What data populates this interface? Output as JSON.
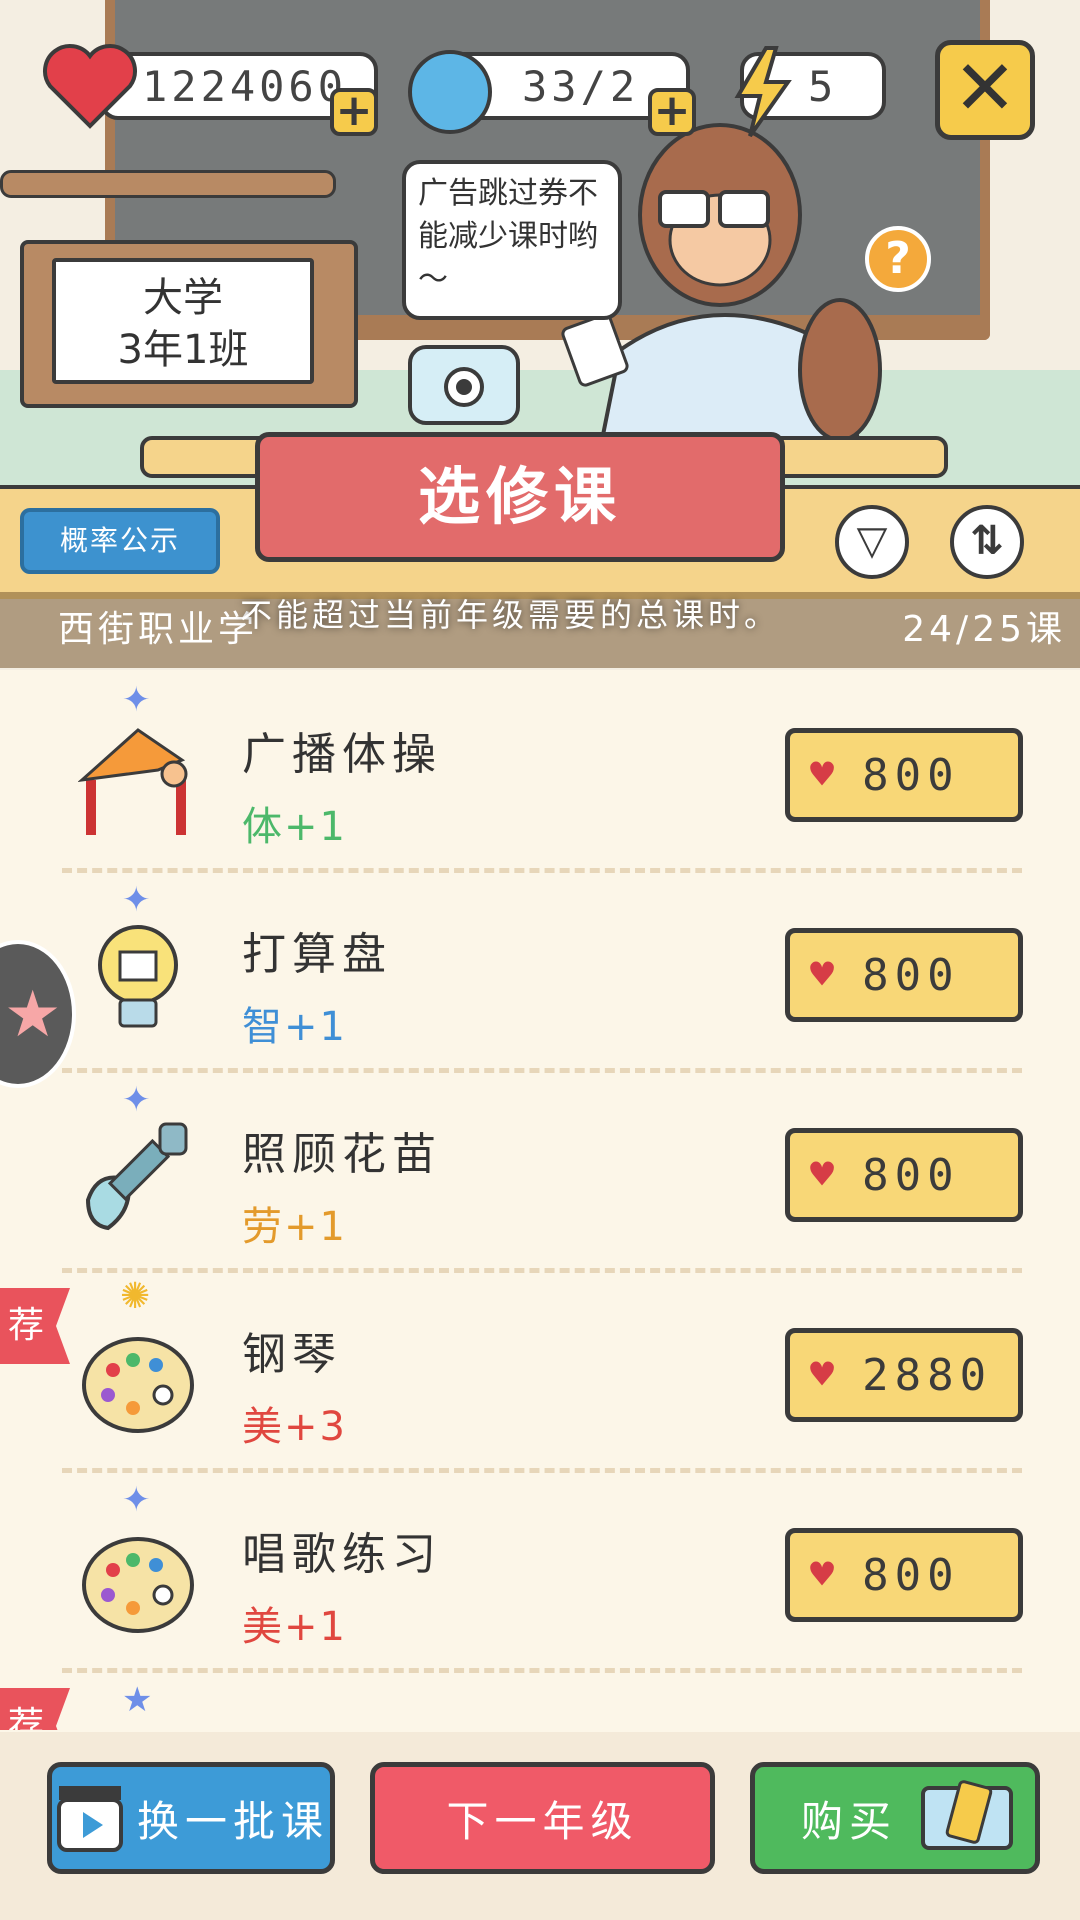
{
  "currencies": {
    "hearts": "1224060",
    "gems": "33/2",
    "energy": "5"
  },
  "sign": {
    "line1": "大学",
    "line2": "3年1班"
  },
  "teacher_speech": "广告跳过券不能减少课时哟～",
  "title": "选修课",
  "probability_label": "概率公示",
  "info_bar": {
    "left": "西街职业学",
    "right": "24/25课"
  },
  "toast": "不能超过当前年级需要的总课时。",
  "courses": [
    {
      "name": "广播体操",
      "stat": "体+1",
      "price": "800",
      "stat_color": "#4cb86a",
      "rank_icon": "star",
      "recommended": false
    },
    {
      "name": "打算盘",
      "stat": "智+1",
      "price": "800",
      "stat_color": "#3f8fd6",
      "rank_icon": "star",
      "recommended": false
    },
    {
      "name": "照顾花苗",
      "stat": "劳+1",
      "price": "800",
      "stat_color": "#e39a2b",
      "rank_icon": "star",
      "recommended": false
    },
    {
      "name": "钢琴",
      "stat": "美+3",
      "price": "2880",
      "stat_color": "#e0473f",
      "rank_icon": "sun",
      "recommended": true
    },
    {
      "name": "唱歌练习",
      "stat": "美+1",
      "price": "800",
      "stat_color": "#e0473f",
      "rank_icon": "star",
      "recommended": false
    }
  ],
  "recommend_tag": "荐",
  "bottom": {
    "refresh_label": "换一批课",
    "next_grade_label": "下一年级",
    "buy_label": "购买"
  },
  "colors": {
    "title_red": "#e26b6b",
    "price_yellow": "#f8d777",
    "refresh_blue": "#3d9bd7",
    "next_red": "#f05a68",
    "buy_green": "#4fba5d"
  }
}
